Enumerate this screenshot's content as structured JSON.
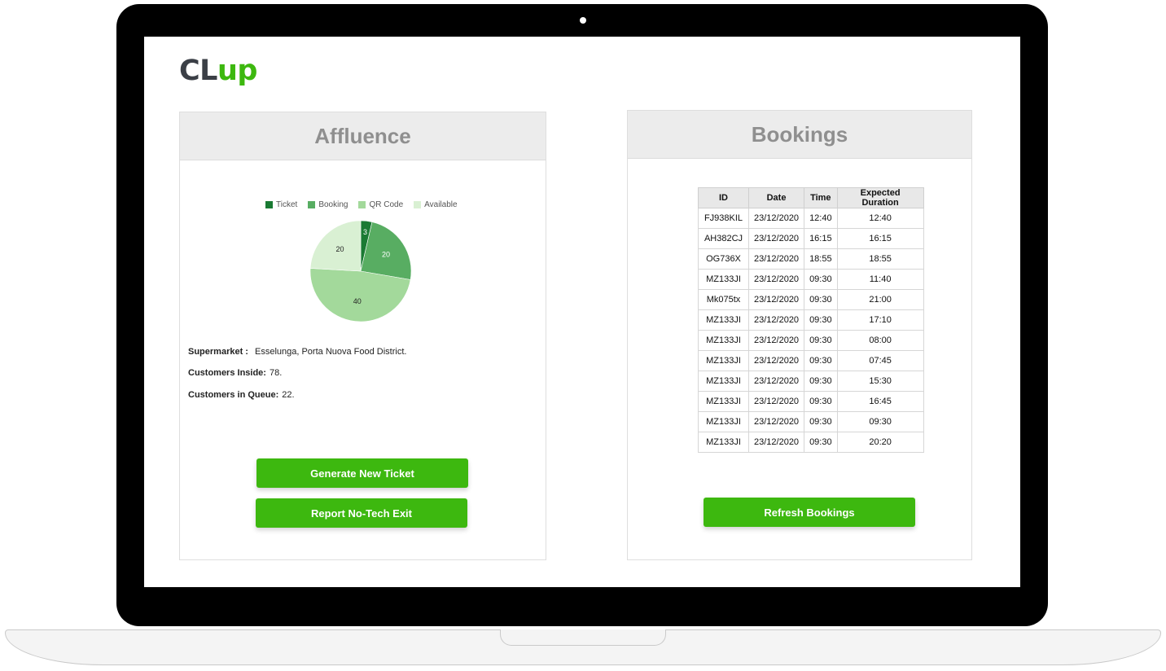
{
  "app": {
    "logo_part1": "CL",
    "logo_part2": "up"
  },
  "affluence": {
    "title": "Affluence",
    "legend": [
      {
        "label": "Ticket",
        "color": "#1a7a33"
      },
      {
        "label": "Booking",
        "color": "#58ad62"
      },
      {
        "label": "QR Code",
        "color": "#a3d99b"
      },
      {
        "label": "Available",
        "color": "#d9f0d3"
      }
    ],
    "supermarket_label": "Supermarket :",
    "supermarket_value": "Esselunga, Porta Nuova Food District.",
    "customers_inside_label": "Customers Inside:",
    "customers_inside_value": "78.",
    "customers_queue_label": "Customers in Queue:",
    "customers_queue_value": "22.",
    "generate_ticket_label": "Generate New Ticket",
    "report_exit_label": "Report No-Tech Exit"
  },
  "chart_data": {
    "type": "pie",
    "categories": [
      "Ticket",
      "Booking",
      "QR Code",
      "Available"
    ],
    "values": [
      3,
      20,
      40,
      20
    ],
    "colors": [
      "#1a7a33",
      "#58ad62",
      "#a3d99b",
      "#d9f0d3"
    ],
    "legend": "top"
  },
  "bookings": {
    "title": "Bookings",
    "columns": [
      "ID",
      "Date",
      "Time",
      "Expected Duration"
    ],
    "rows": [
      [
        "FJ938KIL",
        "23/12/2020",
        "12:40",
        "12:40"
      ],
      [
        "AH382CJ",
        "23/12/2020",
        "16:15",
        "16:15"
      ],
      [
        "OG736X",
        "23/12/2020",
        "18:55",
        "18:55"
      ],
      [
        "MZ133JI",
        "23/12/2020",
        "09:30",
        "11:40"
      ],
      [
        "Mk075tx",
        "23/12/2020",
        "09:30",
        "21:00"
      ],
      [
        "MZ133JI",
        "23/12/2020",
        "09:30",
        "17:10"
      ],
      [
        "MZ133JI",
        "23/12/2020",
        "09:30",
        "08:00"
      ],
      [
        "MZ133JI",
        "23/12/2020",
        "09:30",
        "07:45"
      ],
      [
        "MZ133JI",
        "23/12/2020",
        "09:30",
        "15:30"
      ],
      [
        "MZ133JI",
        "23/12/2020",
        "09:30",
        "16:45"
      ],
      [
        "MZ133JI",
        "23/12/2020",
        "09:30",
        "09:30"
      ],
      [
        "MZ133JI",
        "23/12/2020",
        "09:30",
        "20:20"
      ]
    ],
    "refresh_label": "Refresh Bookings"
  }
}
